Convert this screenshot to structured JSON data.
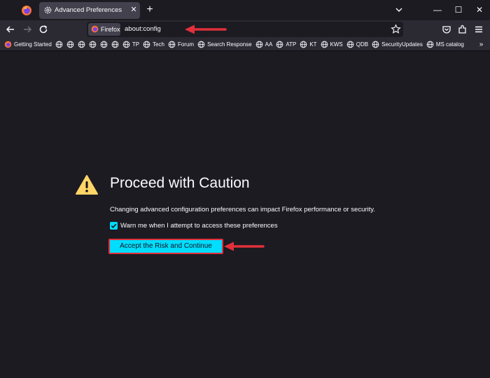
{
  "tabs": [
    {
      "title": "Advanced Preferences",
      "icon": "gear-icon",
      "active": true
    }
  ],
  "tabstrip": {
    "close_glyph": "✕",
    "new_tab_glyph": "+"
  },
  "window_controls": {
    "minimize": "—",
    "maximize": "☐",
    "close": "✕"
  },
  "urlbar": {
    "identity_label": "Firefox",
    "url": "about:config"
  },
  "bookmarks": [
    {
      "label": "Getting Started",
      "icon": "firefox-icon"
    },
    {
      "label": "",
      "icon": "globe-icon"
    },
    {
      "label": "",
      "icon": "globe-icon"
    },
    {
      "label": "",
      "icon": "globe-icon"
    },
    {
      "label": "",
      "icon": "globe-icon"
    },
    {
      "label": "",
      "icon": "globe-icon"
    },
    {
      "label": "",
      "icon": "globe-icon"
    },
    {
      "label": "TP",
      "icon": "globe-icon"
    },
    {
      "label": "Tech",
      "icon": "globe-icon"
    },
    {
      "label": "Forum",
      "icon": "globe-icon"
    },
    {
      "label": "Search Response",
      "icon": "globe-icon"
    },
    {
      "label": "AA",
      "icon": "globe-icon"
    },
    {
      "label": "ATP",
      "icon": "globe-icon"
    },
    {
      "label": "KT",
      "icon": "globe-icon"
    },
    {
      "label": "KWS",
      "icon": "globe-icon"
    },
    {
      "label": "QDB",
      "icon": "globe-icon"
    },
    {
      "label": "SecurityUpdates",
      "icon": "globe-icon"
    },
    {
      "label": "MS catalog",
      "icon": "globe-icon"
    }
  ],
  "bookmarks_overflow": "»",
  "page": {
    "heading": "Proceed with Caution",
    "description": "Changing advanced configuration preferences can impact Firefox performance or security.",
    "checkbox_label": "Warn me when I attempt to access these preferences",
    "checkbox_checked": true,
    "accept_button": "Accept the Risk and Continue"
  },
  "colors": {
    "background": "#1c1b22",
    "toolbar": "#2b2a33",
    "accent": "#00ddff",
    "annotation": "#e2303a",
    "warning": "#ffd567"
  }
}
